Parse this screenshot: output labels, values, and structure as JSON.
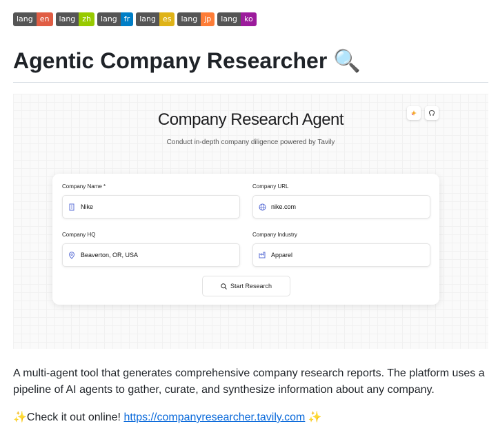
{
  "badges": [
    {
      "label": "lang",
      "value": "en",
      "color": "#e05d44"
    },
    {
      "label": "lang",
      "value": "zh",
      "color": "#97ca00"
    },
    {
      "label": "lang",
      "value": "fr",
      "color": "#007ec6"
    },
    {
      "label": "lang",
      "value": "es",
      "color": "#dfb317"
    },
    {
      "label": "lang",
      "value": "jp",
      "color": "#fe7d37"
    },
    {
      "label": "lang",
      "value": "ko",
      "color": "#9c1b9c"
    }
  ],
  "heading": "Agentic Company Researcher 🔍",
  "screenshot": {
    "title": "Company Research Agent",
    "subtitle": "Conduct in-depth company diligence powered by Tavily",
    "fields": {
      "company_name": {
        "label": "Company Name *",
        "value": "Nike",
        "icon": "building-icon"
      },
      "company_url": {
        "label": "Company URL",
        "value": "nike.com",
        "icon": "globe-icon"
      },
      "company_hq": {
        "label": "Company HQ",
        "value": "Beaverton, OR, USA",
        "icon": "map-pin-icon"
      },
      "company_industry": {
        "label": "Company Industry",
        "value": "Apparel",
        "icon": "industry-icon"
      }
    },
    "start_button": "Start Research"
  },
  "description": "A multi-agent tool that generates comprehensive company research reports. The platform uses a pipeline of AI agents to gather, curate, and synthesize information about any company.",
  "cta": {
    "prefix": "✨Check it out online! ",
    "link_text": "https://companyresearcher.tavily.com",
    "suffix": " ✨"
  }
}
